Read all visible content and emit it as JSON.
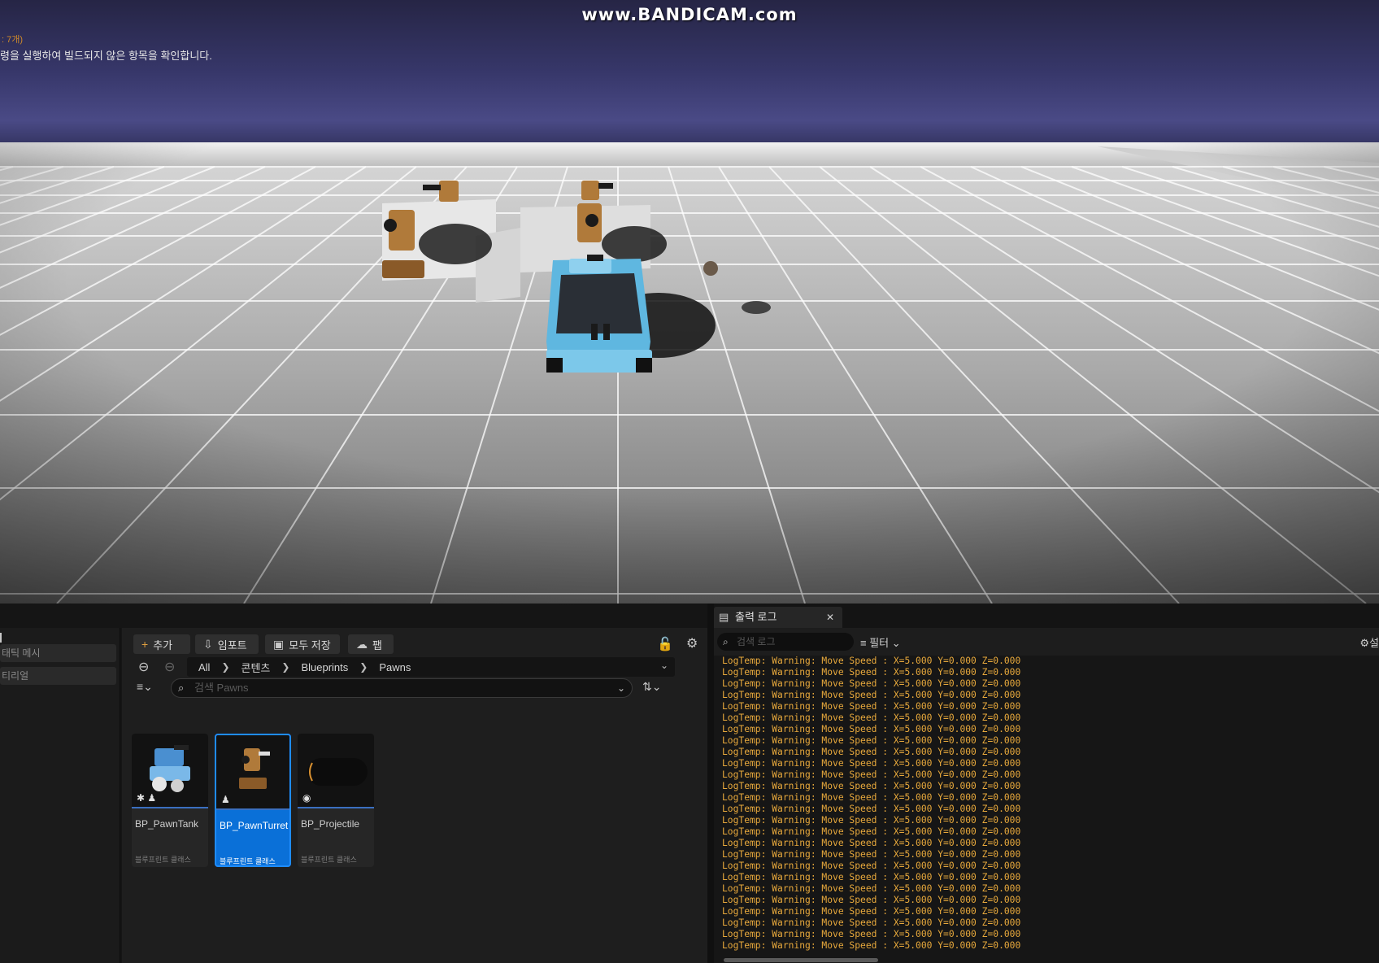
{
  "viewport": {
    "watermark": "www.BANDICAM.com",
    "message_1": ": 7개)",
    "message_2": "령을 실행하여 빌드되지 않은 항목을 확인합니다."
  },
  "left_panel": {
    "items": [
      "태틱 메시",
      "티리얼"
    ]
  },
  "content_browser": {
    "toolbar": {
      "add_label": "추가",
      "import_label": "임포트",
      "save_all_label": "모두 저장",
      "fab_label": "팹"
    },
    "breadcrumb": [
      "All",
      "콘텐츠",
      "Blueprints",
      "Pawns"
    ],
    "search_placeholder": "검색 Pawns",
    "assets": [
      {
        "name": "BP_PawnTank",
        "type": "블루프린트 클래스"
      },
      {
        "name": "BP_PawnTurret",
        "type": "블루프린트 클래스"
      },
      {
        "name": "BP_Projectile",
        "type": "블루프린트 클래스"
      }
    ],
    "selected_asset": "BP_PawnTurret"
  },
  "output_log": {
    "tab_label": "출력 로그",
    "search_placeholder": "검색 로그",
    "filter_label": "필터",
    "settings_label": "설",
    "line_text": "LogTemp: Warning: Move Speed : X=5.000 Y=0.000 Z=0.000",
    "line_count": 26
  },
  "colors": {
    "selection": "#0a70d8",
    "log_warning": "#e8a93c",
    "panel": "#1e1e1e"
  },
  "icons": [
    "plus-icon",
    "import-icon",
    "save-icon",
    "fab-icon",
    "lock-icon",
    "settings-icon",
    "back-icon",
    "forward-icon",
    "filter-icon",
    "search-icon",
    "sort-icon",
    "output-log-icon",
    "close-icon"
  ]
}
